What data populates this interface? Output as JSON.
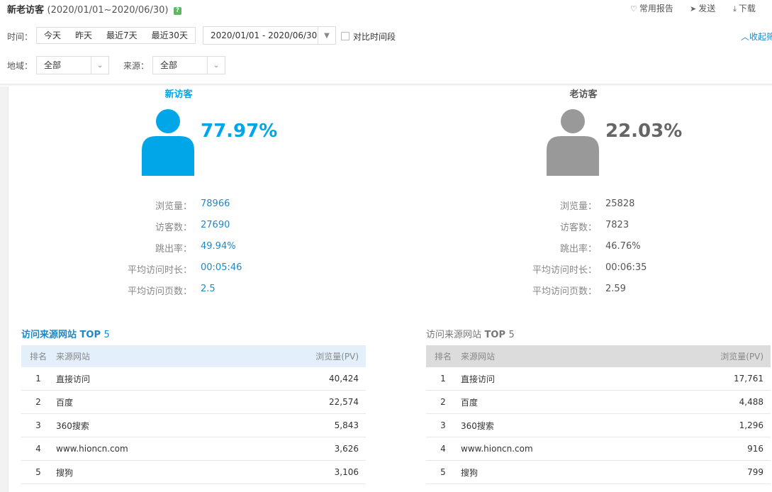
{
  "header": {
    "title": "新老访客",
    "date_range": "(2020/01/01~2020/06/30)",
    "help_icon": "?",
    "actions": [
      {
        "icon": "heart-icon",
        "glyph": "♡",
        "label": "常用报告"
      },
      {
        "icon": "send-icon",
        "glyph": "➤",
        "label": "发送"
      },
      {
        "icon": "download-icon",
        "glyph": "⤓",
        "label": "下载"
      }
    ]
  },
  "filters": {
    "time_label": "时间：",
    "time_options": [
      "今天",
      "昨天",
      "最近7天",
      "最近30天"
    ],
    "date_value": "2020/01/01 - 2020/06/30",
    "compare_label": "对比时间段",
    "collapse_label": "收起筛选",
    "region_label": "地域：",
    "region_value": "全部",
    "source_label": "来源：",
    "source_value": "全部"
  },
  "colors": {
    "new": "#00a6e8",
    "old": "#999999",
    "link": "#1e88c7"
  },
  "new_visitor": {
    "title": "新访客",
    "percent": "77.97%",
    "stats": [
      {
        "label": "浏览量：",
        "value": "78966"
      },
      {
        "label": "访客数：",
        "value": "27690"
      },
      {
        "label": "跳出率：",
        "value": "49.94%"
      },
      {
        "label": "平均访问时长：",
        "value": "00:05:46"
      },
      {
        "label": "平均访问页数：",
        "value": "2.5"
      }
    ],
    "table": {
      "title": "访问来源网站",
      "top": "TOP",
      "top_n": "5",
      "columns": [
        "排名",
        "来源网站",
        "浏览量(PV)"
      ],
      "rows": [
        [
          "1",
          "直接访问",
          "40,424"
        ],
        [
          "2",
          "百度",
          "22,574"
        ],
        [
          "3",
          "360搜索",
          "5,843"
        ],
        [
          "4",
          "www.hioncn.com",
          "3,626"
        ],
        [
          "5",
          "搜狗",
          "3,106"
        ]
      ]
    }
  },
  "old_visitor": {
    "title": "老访客",
    "percent": "22.03%",
    "stats": [
      {
        "label": "浏览量：",
        "value": "25828"
      },
      {
        "label": "访客数：",
        "value": "7823"
      },
      {
        "label": "跳出率：",
        "value": "46.76%"
      },
      {
        "label": "平均访问时长：",
        "value": "00:06:35"
      },
      {
        "label": "平均访问页数：",
        "value": "2.59"
      }
    ],
    "table": {
      "title": "访问来源网站",
      "top": "TOP",
      "top_n": "5",
      "columns": [
        "排名",
        "来源网站",
        "浏览量(PV)"
      ],
      "rows": [
        [
          "1",
          "直接访问",
          "17,761"
        ],
        [
          "2",
          "百度",
          "4,488"
        ],
        [
          "3",
          "360搜索",
          "1,296"
        ],
        [
          "4",
          "www.hioncn.com",
          "916"
        ],
        [
          "5",
          "搜狗",
          "799"
        ]
      ]
    }
  }
}
